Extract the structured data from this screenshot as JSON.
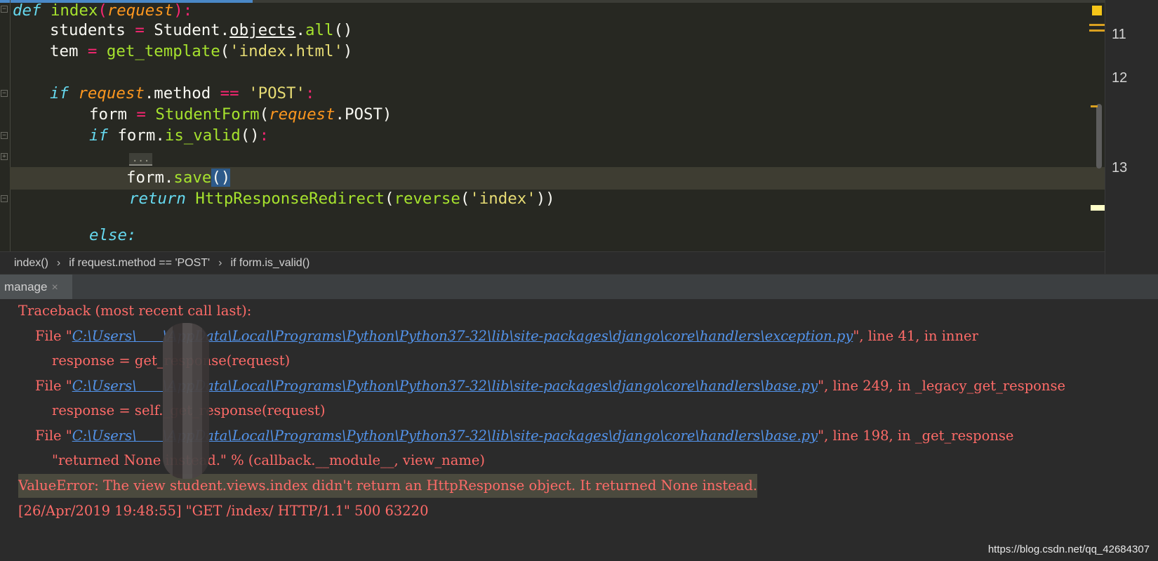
{
  "editor": {
    "code": {
      "l1": {
        "kw": "def",
        "fn": "index",
        "paren_open": "(",
        "param": "request",
        "paren_close": ")",
        "colon": ":"
      },
      "l2": {
        "name": "students",
        "eq": " = ",
        "cls": "Student.",
        "attr": "objects",
        "rest": ".",
        "call": "all",
        "paren": "()"
      },
      "l3": {
        "name": "tem",
        "eq": " = ",
        "fn": "get_template",
        "open": "(",
        "str": "'index.html'",
        "close": ")"
      },
      "l4": {
        "kw": "if",
        "param": "request",
        "attr": ".method ",
        "op": "==",
        "str": " 'POST'",
        "colon": ":"
      },
      "l5": {
        "name": "form",
        "eq": " = ",
        "cls": "StudentForm",
        "open": "(",
        "param": "request",
        "rest": ".POST)"
      },
      "l6": {
        "kw": "if",
        "rest": " form.",
        "fn": "is_valid",
        "paren": "()",
        "colon": ":"
      },
      "l7": {
        "folded": "..."
      },
      "l8": {
        "name": "form.",
        "fn": "save",
        "sel": "()"
      },
      "l9": {
        "kw": "return",
        "cls": "HttpResponseRedirect",
        "open": "(",
        "fn": "reverse",
        "open2": "(",
        "str": "'index'",
        "close": "))"
      },
      "l10": {
        "partial": "else:"
      }
    },
    "line_numbers": [
      "11",
      "12",
      "13"
    ]
  },
  "breadcrumbs": [
    "index()",
    "if request.method == 'POST'",
    "if form.is_valid()"
  ],
  "crumb_separator": "›",
  "tab": {
    "label": "manage",
    "close": "×"
  },
  "console": {
    "traceback_header": "Traceback (most recent call last):",
    "frames": [
      {
        "prefix": "File \"",
        "path": "C:\\Users\\      \\AppData\\Local\\Programs\\Python\\Python37-32\\lib\\site-packages\\django\\core\\handlers\\exception.py",
        "suffix": "\", line 41, in inner",
        "code": "response = get_response(request)"
      },
      {
        "prefix": "File \"",
        "path": "C:\\Users\\      \\AppData\\Local\\Programs\\Python\\Python37-32\\lib\\site-packages\\django\\core\\handlers\\base.py",
        "suffix": "\", line 249, in _legacy_get_response",
        "code": "response = self._get_response(request)"
      },
      {
        "prefix": "File \"",
        "path": "C:\\Users\\      \\AppData\\Local\\Programs\\Python\\Python37-32\\lib\\site-packages\\django\\core\\handlers\\base.py",
        "suffix": "\", line 198, in _get_response",
        "code": "\"returned None instead.\" % (callback.__module__, view_name)"
      }
    ],
    "error": "ValueError: The view student.views.index didn't return an HttpResponse object. It returned None instead.",
    "log": "[26/Apr/2019 19:48:55] \"GET /index/ HTTP/1.1\" 500 63220"
  },
  "watermark": "https://blog.csdn.net/qq_42684307",
  "colors": {
    "keyword": "#66d9ef",
    "function": "#a6e22e",
    "param": "#fd971f",
    "string": "#e6db74",
    "operator": "#f92672",
    "console_error": "#ff6b68",
    "link": "#5394ec"
  }
}
